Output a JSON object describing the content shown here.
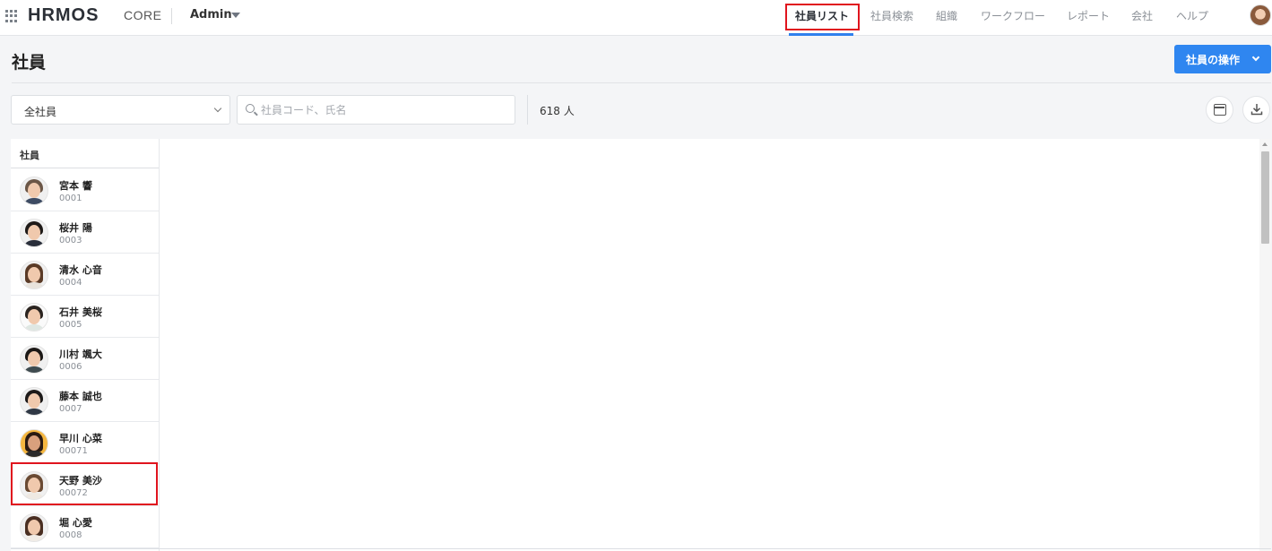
{
  "app": {
    "logo": "HRMOS",
    "logo_sub": "CORE",
    "role": "Admin"
  },
  "nav": {
    "items": [
      {
        "label": "社員リスト",
        "active": true
      },
      {
        "label": "社員検索"
      },
      {
        "label": "組織"
      },
      {
        "label": "ワークフロー"
      },
      {
        "label": "レポート"
      },
      {
        "label": "会社"
      },
      {
        "label": "ヘルプ"
      }
    ]
  },
  "page": {
    "title": "社員",
    "ops_button": "社員の操作"
  },
  "filters": {
    "scope": "全社員",
    "search_placeholder": "社員コード、氏名",
    "count": "618 人"
  },
  "table": {
    "column_header": "社員",
    "rows": [
      {
        "name": "宮本 響",
        "code": "0001"
      },
      {
        "name": "桜井 陽",
        "code": "0003"
      },
      {
        "name": "清水 心音",
        "code": "0004"
      },
      {
        "name": "石井 美桜",
        "code": "0005"
      },
      {
        "name": "川村 颯大",
        "code": "0006"
      },
      {
        "name": "藤本 誠也",
        "code": "0007"
      },
      {
        "name": "早川 心菜",
        "code": "00071"
      },
      {
        "name": "天野 美沙",
        "code": "00072"
      },
      {
        "name": "堀 心愛",
        "code": "0008"
      }
    ]
  },
  "colors": {
    "accent": "#2f86f0",
    "highlight": "#e0141e"
  }
}
